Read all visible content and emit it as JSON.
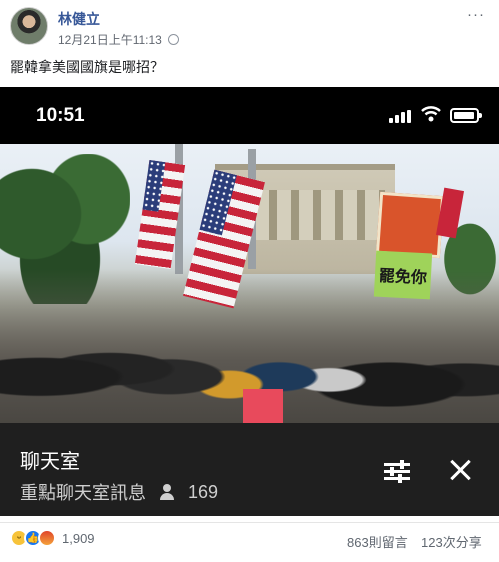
{
  "post": {
    "author": "林健立",
    "timestamp": "12月21日上午11:13",
    "caption": "罷韓拿美國國旗是哪招？"
  },
  "video": {
    "status_time": "10:51",
    "sign_text": "罷免你",
    "chat": {
      "title": "聊天室",
      "subtitle": "重點聊天室訊息",
      "viewer_count": "169"
    }
  },
  "footer": {
    "reaction_count": "1,909",
    "comments": "863則留言",
    "shares": "123次分享"
  },
  "icons": {
    "visibility": "globe-icon",
    "settings": "settings-sliders-icon",
    "close": "close-icon",
    "viewers": "person-icon"
  },
  "colors": {
    "author_link": "#385898",
    "chat_background": "#1f1f1f",
    "like_blue": "#1877f2"
  }
}
